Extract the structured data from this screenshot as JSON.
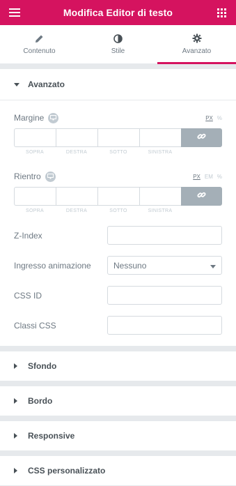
{
  "header": {
    "title": "Modifica Editor di testo"
  },
  "tabs": [
    {
      "label": "Contenuto",
      "icon": "pencil-icon"
    },
    {
      "label": "Stile",
      "icon": "half-circle-icon"
    },
    {
      "label": "Avanzato",
      "icon": "gear-icon",
      "active": true
    }
  ],
  "section": {
    "title": "Avanzato",
    "margin": {
      "label": "Margine",
      "units": [
        "PX",
        "%"
      ],
      "active_unit": "PX",
      "captions": [
        "SOPRA",
        "DESTRA",
        "SOTTO",
        "SINISTRA"
      ]
    },
    "padding": {
      "label": "Rientro",
      "units": [
        "PX",
        "EM",
        "%"
      ],
      "active_unit": "PX",
      "captions": [
        "SOPRA",
        "DESTRA",
        "SOTTO",
        "SINISTRA"
      ]
    },
    "zindex": {
      "label": "Z-Index",
      "value": ""
    },
    "animation": {
      "label": "Ingresso animazione",
      "value": "Nessuno"
    },
    "css_id": {
      "label": "CSS ID",
      "value": ""
    },
    "css_classes": {
      "label": "Classi CSS",
      "value": ""
    }
  },
  "collapsed_sections": [
    "Sfondo",
    "Bordo",
    "Responsive",
    "CSS personalizzato"
  ],
  "colors": {
    "accent": "#d5135f",
    "link_button": "#a4afb7"
  }
}
